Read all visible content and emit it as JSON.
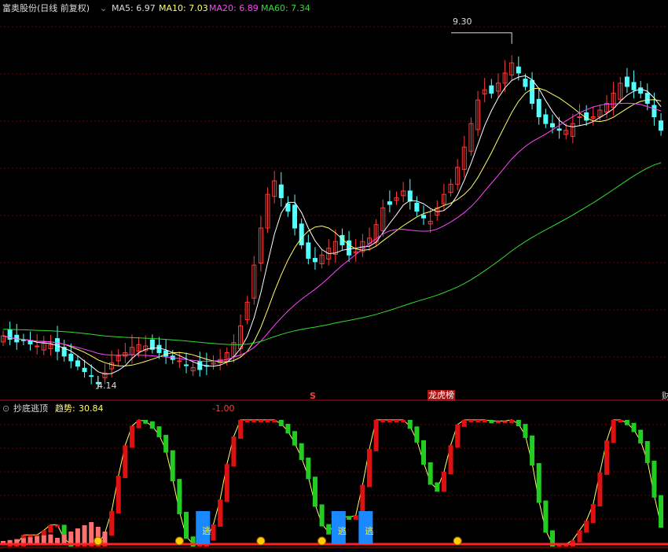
{
  "header": {
    "title": "富奥股份(日线 前复权)",
    "ma5": "MA5: 6.97",
    "ma10": "MA10: 7.03",
    "ma20": "MA20: 6.89",
    "ma60": "MA60: 7.34"
  },
  "sub_header": {
    "title": "抄底逃顶",
    "trend_label": "趋势:",
    "trend_value": "30.84",
    "neg_value": "-1.00"
  },
  "labels": {
    "high_price": "9.30",
    "low_price": "4.14",
    "marker_s": "S",
    "marker_dragon": "龙虎榜",
    "marker_edge": "财",
    "escape": "逃"
  },
  "colors": {
    "background": "#000000",
    "up": "#ff3a3a",
    "down": "#54ffff",
    "ma5": "#ffffff",
    "ma10": "#ffff66",
    "ma20": "#ff44ff",
    "ma60": "#33dd33",
    "grid": "#7a0000",
    "header_text": "#c8c8c8"
  },
  "chart_data": [
    {
      "type": "candlestick",
      "title": "富奥股份(日线 前复权)",
      "ylim": [
        4.0,
        9.6
      ],
      "annotations": [
        "9.30",
        "4.14"
      ],
      "series": [
        {
          "name": "MA5",
          "value": 6.97
        },
        {
          "name": "MA10",
          "value": 7.03
        },
        {
          "name": "MA20",
          "value": 6.89
        },
        {
          "name": "MA60",
          "value": 7.34
        }
      ],
      "ohlc_seeds": [
        4.85,
        4.8,
        4.76,
        4.78,
        4.73,
        4.7,
        4.75,
        4.72,
        4.62,
        4.55,
        4.48,
        4.4,
        4.32,
        4.25,
        4.14,
        4.3,
        4.45,
        4.55,
        4.6,
        4.68,
        4.72,
        4.7,
        4.65,
        4.6,
        4.55,
        4.5,
        4.48,
        4.42,
        4.38,
        4.35,
        4.4,
        4.45,
        4.5,
        4.6,
        4.75,
        5.0,
        5.35,
        5.9,
        6.45,
        6.95,
        7.15,
        6.9,
        6.7,
        6.45,
        6.2,
        6.0,
        5.95,
        6.05,
        6.15,
        6.25,
        6.2,
        6.05,
        6.1,
        6.25,
        6.3,
        6.5,
        6.75,
        6.8,
        6.9,
        7.0,
        6.85,
        6.7,
        6.6,
        6.55,
        6.75,
        6.95,
        7.1,
        7.35,
        7.65,
        8.0,
        8.35,
        8.5,
        8.45,
        8.6,
        8.75,
        8.9,
        8.75,
        8.55,
        8.3,
        8.1,
        8.0,
        7.95,
        7.9,
        7.9,
        8.0,
        8.1,
        8.05,
        8.1,
        8.2,
        8.3,
        8.45,
        8.6,
        8.55,
        8.5,
        8.45,
        8.3,
        8.1,
        7.9
      ]
    },
    {
      "type": "bar",
      "title": "抄底逃顶",
      "series": [
        {
          "name": "趋势",
          "value": 30.84
        }
      ],
      "ylim": [
        -1.0,
        100
      ],
      "categories_count": 98,
      "escape_markers": 3
    }
  ]
}
